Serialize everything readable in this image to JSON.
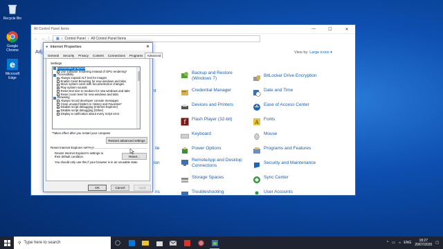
{
  "desktop": {
    "icons": [
      {
        "label": "Recycle Bin",
        "icon": "recycle-bin-icon"
      },
      {
        "label": "Google Chrome",
        "icon": "chrome-icon"
      },
      {
        "label": "Microsoft Edge",
        "icon": "edge-icon"
      }
    ]
  },
  "control_panel": {
    "title": "All Control Panel Items",
    "breadcrumb": [
      "Control Panel",
      "All Control Panel Items"
    ],
    "heading": "Adj",
    "view_by_label": "View by:",
    "view_by_value": "Large icons",
    "items": [
      {
        "label": "Backup and Restore (Windows 7)",
        "icon": "backup-restore-icon"
      },
      {
        "label": "BitLocker Drive Encryption",
        "icon": "bitlocker-icon"
      },
      {
        "label": "Credential Manager",
        "icon": "credential-manager-icon"
      },
      {
        "label": "Date and Time",
        "icon": "date-time-icon"
      },
      {
        "label": "Devices and Printers",
        "icon": "devices-printers-icon"
      },
      {
        "label": "Ease of Access Center",
        "icon": "ease-of-access-icon"
      },
      {
        "label": "Flash Player (32-bit)",
        "icon": "flash-player-icon"
      },
      {
        "label": "Fonts",
        "icon": "fonts-icon"
      },
      {
        "label": "Keyboard",
        "icon": "keyboard-icon"
      },
      {
        "label": "Mouse",
        "icon": "mouse-icon"
      },
      {
        "label": "Power Options",
        "icon": "power-options-icon"
      },
      {
        "label": "Programs and Features",
        "icon": "programs-features-icon"
      },
      {
        "label": "RemoteApp and Desktop Connections",
        "icon": "remoteapp-icon"
      },
      {
        "label": "Security and Maintenance",
        "icon": "security-maintenance-icon"
      },
      {
        "label": "Storage Spaces",
        "icon": "storage-spaces-icon"
      },
      {
        "label": "Sync Center",
        "icon": "sync-center-icon"
      },
      {
        "label": "Troubleshooting",
        "icon": "troubleshooting-icon"
      },
      {
        "label": "User Accounts",
        "icon": "user-accounts-icon"
      }
    ],
    "partial_left": [
      "nt",
      "ile",
      "ion",
      "ns"
    ]
  },
  "internet_properties": {
    "title": "Internet Properties",
    "tabs": [
      "General",
      "Security",
      "Privacy",
      "Content",
      "Connections",
      "Programs",
      "Advanced"
    ],
    "active_tab": "Advanced",
    "settings_label": "Settings",
    "settings_rows": [
      {
        "text": "Accelerated graphics",
        "type": "category",
        "selected": true
      },
      {
        "text": "Use software rendering instead of GPU rendering*",
        "type": "checkbox"
      },
      {
        "text": "Accessibility",
        "type": "category"
      },
      {
        "text": "Always expand ALT text for images",
        "type": "checkbox"
      },
      {
        "text": "Enable Caret Browsing for new windows and tabs",
        "type": "checkbox"
      },
      {
        "text": "Move system caret with focus/selection changes",
        "type": "checkbox"
      },
      {
        "text": "Play system sounds",
        "type": "checkbox"
      },
      {
        "text": "Reset text size to medium for new windows and tabs",
        "type": "checkbox"
      },
      {
        "text": "Reset zoom level for new windows and tabs",
        "type": "checkbox"
      },
      {
        "text": "Browsing",
        "type": "category"
      },
      {
        "text": "Always record developer console messages",
        "type": "checkbox"
      },
      {
        "text": "Close unused folders in History and Favorites*",
        "type": "checkbox"
      },
      {
        "text": "Disable script debugging (Internet Explorer)",
        "type": "checkbox"
      },
      {
        "text": "Disable script debugging (Other)",
        "type": "checkbox"
      },
      {
        "text": "Display a notification about every script error",
        "type": "checkbox"
      }
    ],
    "restart_note": "*Takes effect after you restart your computer",
    "restore_button": "Restore advanced settings",
    "reset_heading": "Reset Internet Explorer settings",
    "reset_desc": "Resets Internet Explorer's settings to their default condition.",
    "reset_button": "Reset...",
    "reset_warning": "You should only use this if your browser is in an unusable state.",
    "ok_button": "OK",
    "cancel_button": "Cancel",
    "apply_button": "Apply"
  },
  "taskbar": {
    "search_placeholder": "Type here to search",
    "language": "ENG",
    "time": "18:27",
    "date": "20/07/2020"
  },
  "colors": {
    "link_blue": "#1a5fb4",
    "taskbar_bg": "#1f2430",
    "selection_blue": "#0078d7"
  }
}
